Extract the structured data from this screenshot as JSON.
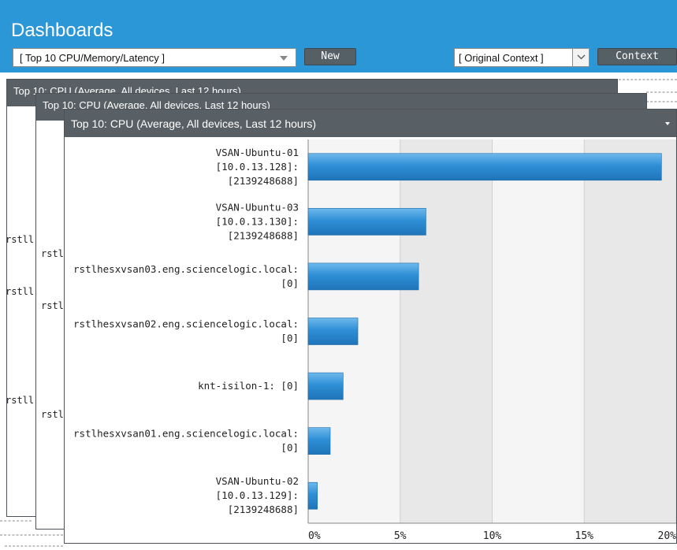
{
  "header": {
    "title": "Dashboards",
    "dashboard_select": "[ Top 10 CPU/Memory/Latency ]",
    "new_label": "New",
    "context_select": "[ Original Context ]",
    "context_label": "Context"
  },
  "panels": {
    "back_title": "Top 10: CPU (Average, All devices, Last 12 hours)",
    "middle_title": "Top 10: CPU (Average, All devices, Last 12 hours)",
    "front_title": "Top 10: CPU (Average, All devices, Last 12 hours)",
    "back_label": "rstll",
    "middle_label": "rstll"
  },
  "colors": {
    "header": "#2c97d6",
    "bar": "#2e8fd6",
    "panel_title": "#596065"
  },
  "icons": {
    "dropdown": "chevron-down-icon",
    "panel_menu": "caret-down-icon"
  },
  "chart_data": {
    "type": "bar",
    "orientation": "horizontal",
    "title": "Top 10: CPU (Average, All devices, Last 12 hours)",
    "categories": [
      [
        "VSAN-Ubuntu-01",
        "[10.0.13.128]:",
        "[2139248688]"
      ],
      [
        "VSAN-Ubuntu-03",
        "[10.0.13.130]:",
        "[2139248688]"
      ],
      [
        "rstlhesxvsan03.eng.sciencelogic.local:",
        "[0]"
      ],
      [
        "rstlhesxvsan02.eng.sciencelogic.local:",
        "[0]"
      ],
      [
        "knt-isilon-1: [0]"
      ],
      [
        "rstlhesxvsan01.eng.sciencelogic.local:",
        "[0]"
      ],
      [
        "VSAN-Ubuntu-02",
        "[10.0.13.129]:",
        "[2139248688]"
      ]
    ],
    "values": [
      19.2,
      6.4,
      6.0,
      2.7,
      1.9,
      1.2,
      0.5
    ],
    "xlim": [
      0,
      20
    ],
    "xticks": [
      "0%",
      "5%",
      "10%",
      "15%",
      "20%"
    ],
    "grid": "alternating vertical bands"
  }
}
